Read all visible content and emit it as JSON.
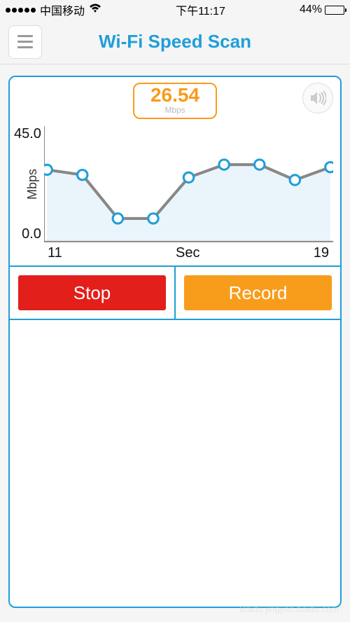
{
  "status": {
    "carrier": "中国移动",
    "time": "下午11:17",
    "battery": "44%"
  },
  "header": {
    "title": "Wi-Fi Speed Scan"
  },
  "speed": {
    "value": "26.54",
    "unit": "Mbps"
  },
  "buttons": {
    "stop": "Stop",
    "record": "Record"
  },
  "colors": {
    "accent": "#1f9fd8",
    "stop": "#e21f1a",
    "record": "#f89c1c"
  },
  "chart_data": {
    "type": "line",
    "title": "",
    "xlabel": "Sec",
    "ylabel": "Mbps",
    "xlim": [
      11,
      19
    ],
    "ylim": [
      0,
      45
    ],
    "x": [
      11,
      12,
      13,
      14,
      15,
      16,
      17,
      18,
      19
    ],
    "values": [
      28,
      26,
      9,
      9,
      25,
      30,
      30,
      24,
      29
    ],
    "yticks": [
      "0.0",
      "45.0"
    ],
    "xticks": [
      "11",
      "19"
    ]
  },
  "watermark": "Baidu jingyan.baidu.com"
}
